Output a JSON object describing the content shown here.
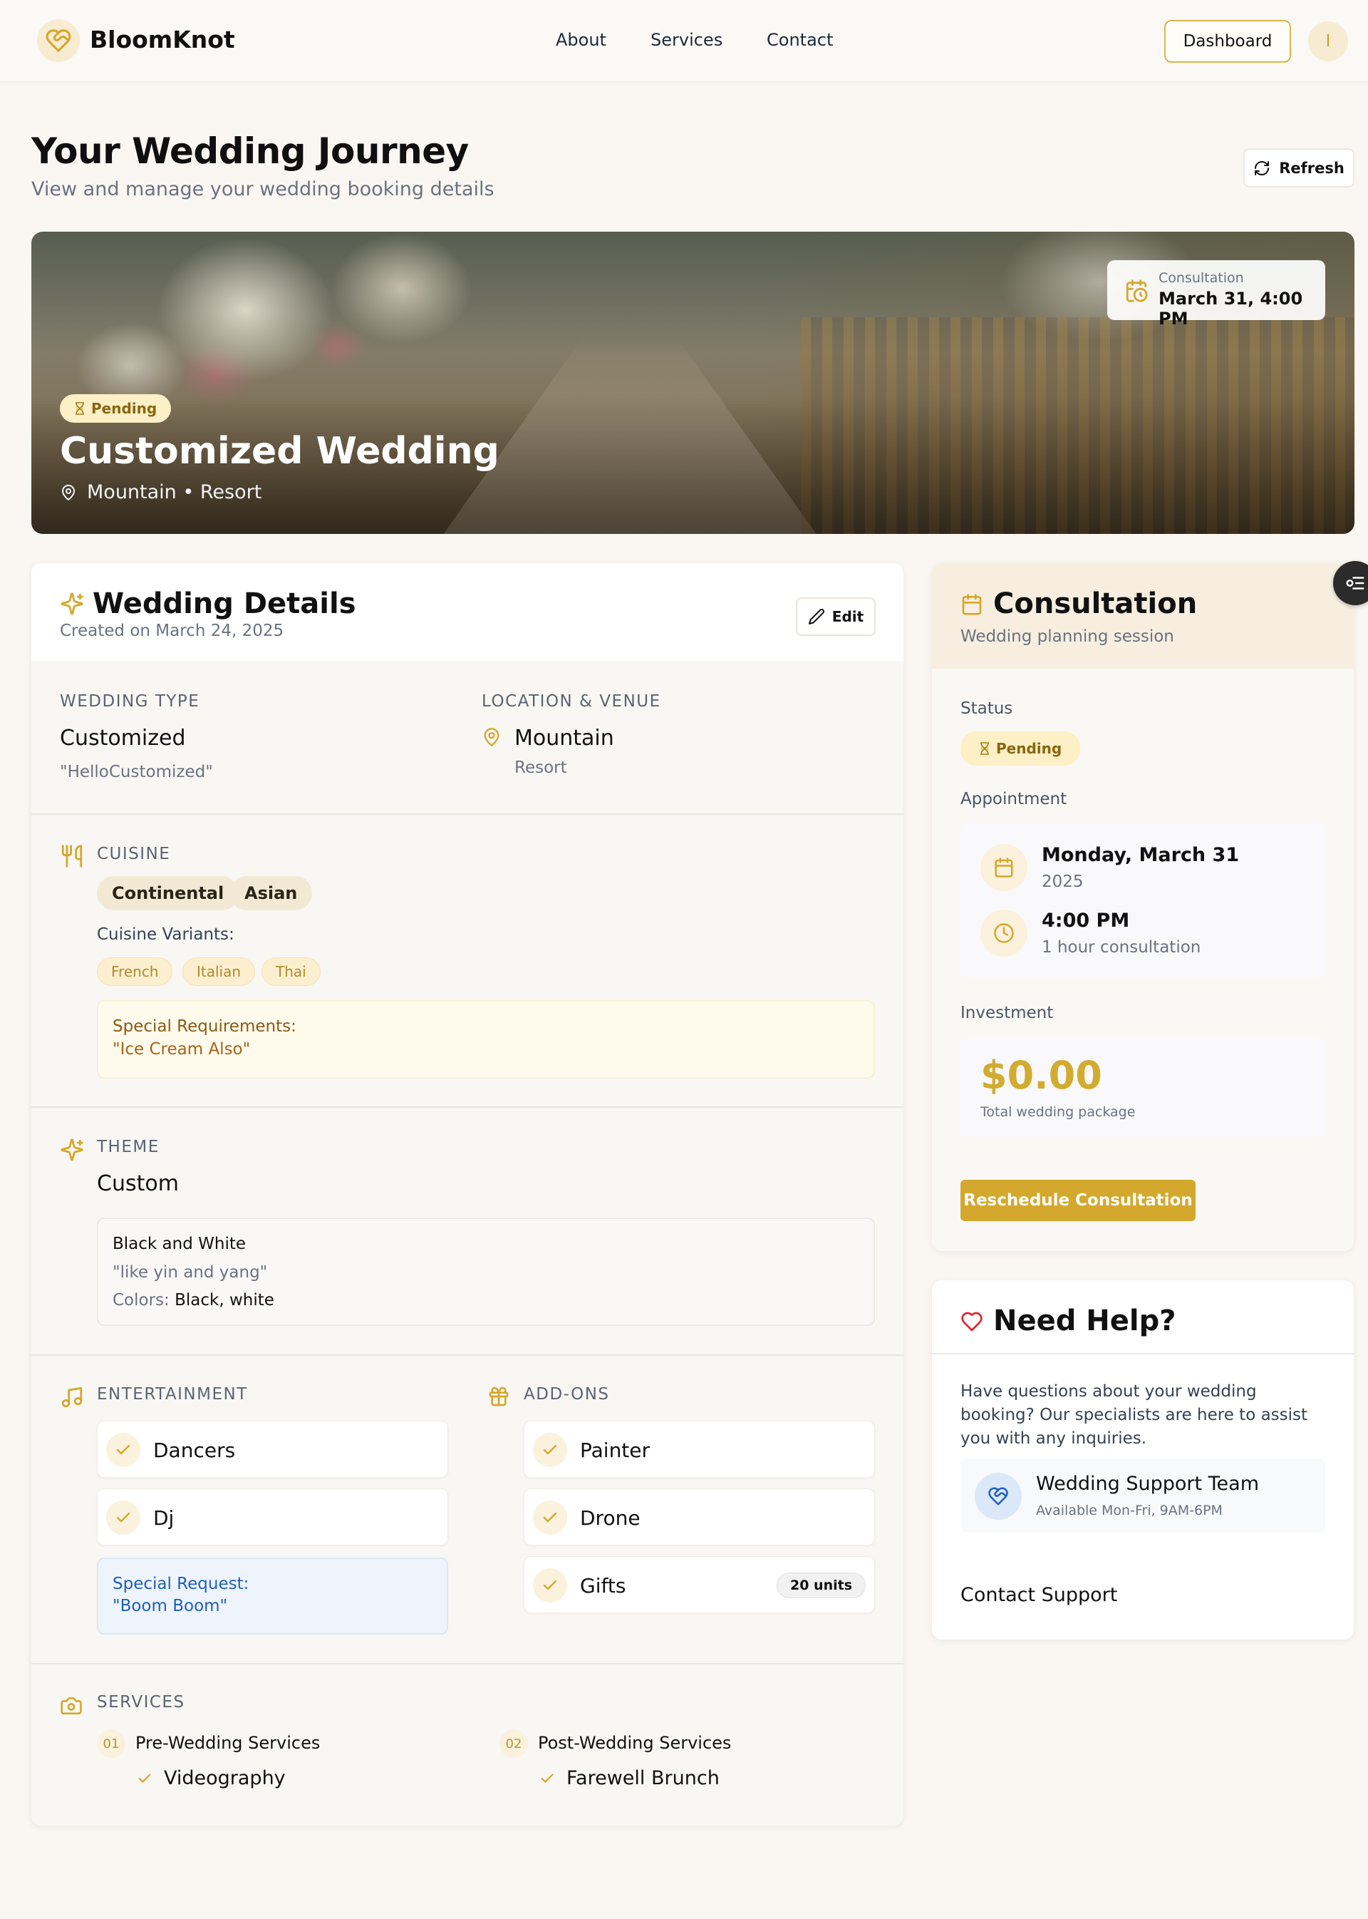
{
  "app": {
    "name": "BloomKnot",
    "logo_icon": "heart-knot-icon"
  },
  "nav": {
    "links": [
      "About",
      "Services",
      "Contact"
    ],
    "dashboard_label": "Dashboard",
    "avatar_initial": "I"
  },
  "page": {
    "title": "Your Wedding Journey",
    "subtitle": "View and manage your wedding booking details",
    "refresh_label": "Refresh"
  },
  "hero": {
    "status": "Pending",
    "title": "Customized Wedding",
    "location": "Mountain • Resort",
    "consultation_label": "Consultation",
    "consultation_value": "March 31, 4:00 PM"
  },
  "details": {
    "title": "Wedding Details",
    "created": "Created on March 24, 2025",
    "edit_label": "Edit",
    "wedding_type_label": "WEDDING TYPE",
    "wedding_type": "Customized",
    "wedding_type_note": "\"HelloCustomized\"",
    "location_label": "LOCATION & VENUE",
    "location": "Mountain",
    "venue": "Resort",
    "cuisine_label": "CUISINE",
    "cuisines": [
      "Continental",
      "Asian"
    ],
    "variants_label": "Cuisine Variants:",
    "variants": [
      "French",
      "Italian",
      "Thai"
    ],
    "special_req_label": "Special Requirements:",
    "special_req": "\"Ice Cream Also\"",
    "theme_label": "THEME",
    "theme": "Custom",
    "theme_name": "Black and White",
    "theme_quote": "\"like yin and yang\"",
    "colors_label": "Colors:",
    "colors": "Black, white",
    "entertainment_label": "ENTERTAINMENT",
    "entertainment": [
      "Dancers",
      "Dj"
    ],
    "ent_request_label": "Special Request:",
    "ent_request": "\"Boom Boom\"",
    "addons_label": "ADD-ONS",
    "addons": [
      "Painter",
      "Drone",
      "Gifts"
    ],
    "gifts_units": "20 units",
    "services_label": "SERVICES",
    "services": [
      {
        "num": "01",
        "title": "Pre-Wedding Services",
        "item": "Videography"
      },
      {
        "num": "02",
        "title": "Post-Wedding Services",
        "item": "Farewell Brunch"
      }
    ]
  },
  "consultation": {
    "title": "Consultation",
    "subtitle": "Wedding planning session",
    "status_label": "Status",
    "status": "Pending",
    "appointment_label": "Appointment",
    "date": "Monday, March 31",
    "year": "2025",
    "time": "4:00 PM",
    "duration": "1 hour consultation",
    "investment_label": "Investment",
    "amount": "$0.00",
    "amount_note": "Total wedding package",
    "reschedule_label": "Reschedule Consultation"
  },
  "help": {
    "title": "Need Help?",
    "text": "Have questions about your wedding booking? Our specialists are here to assist you with any inquiries.",
    "team_name": "Wedding Support Team",
    "team_hours": "Available Mon-Fri, 9AM-6PM",
    "contact_label": "Contact Support"
  },
  "colors": {
    "accent": "#D4A82C",
    "accent_light": "#FBF1DC",
    "pending_bg": "#FDF0C6",
    "info_blue": "#1F5FB8",
    "help_heart": "#DC2626"
  }
}
